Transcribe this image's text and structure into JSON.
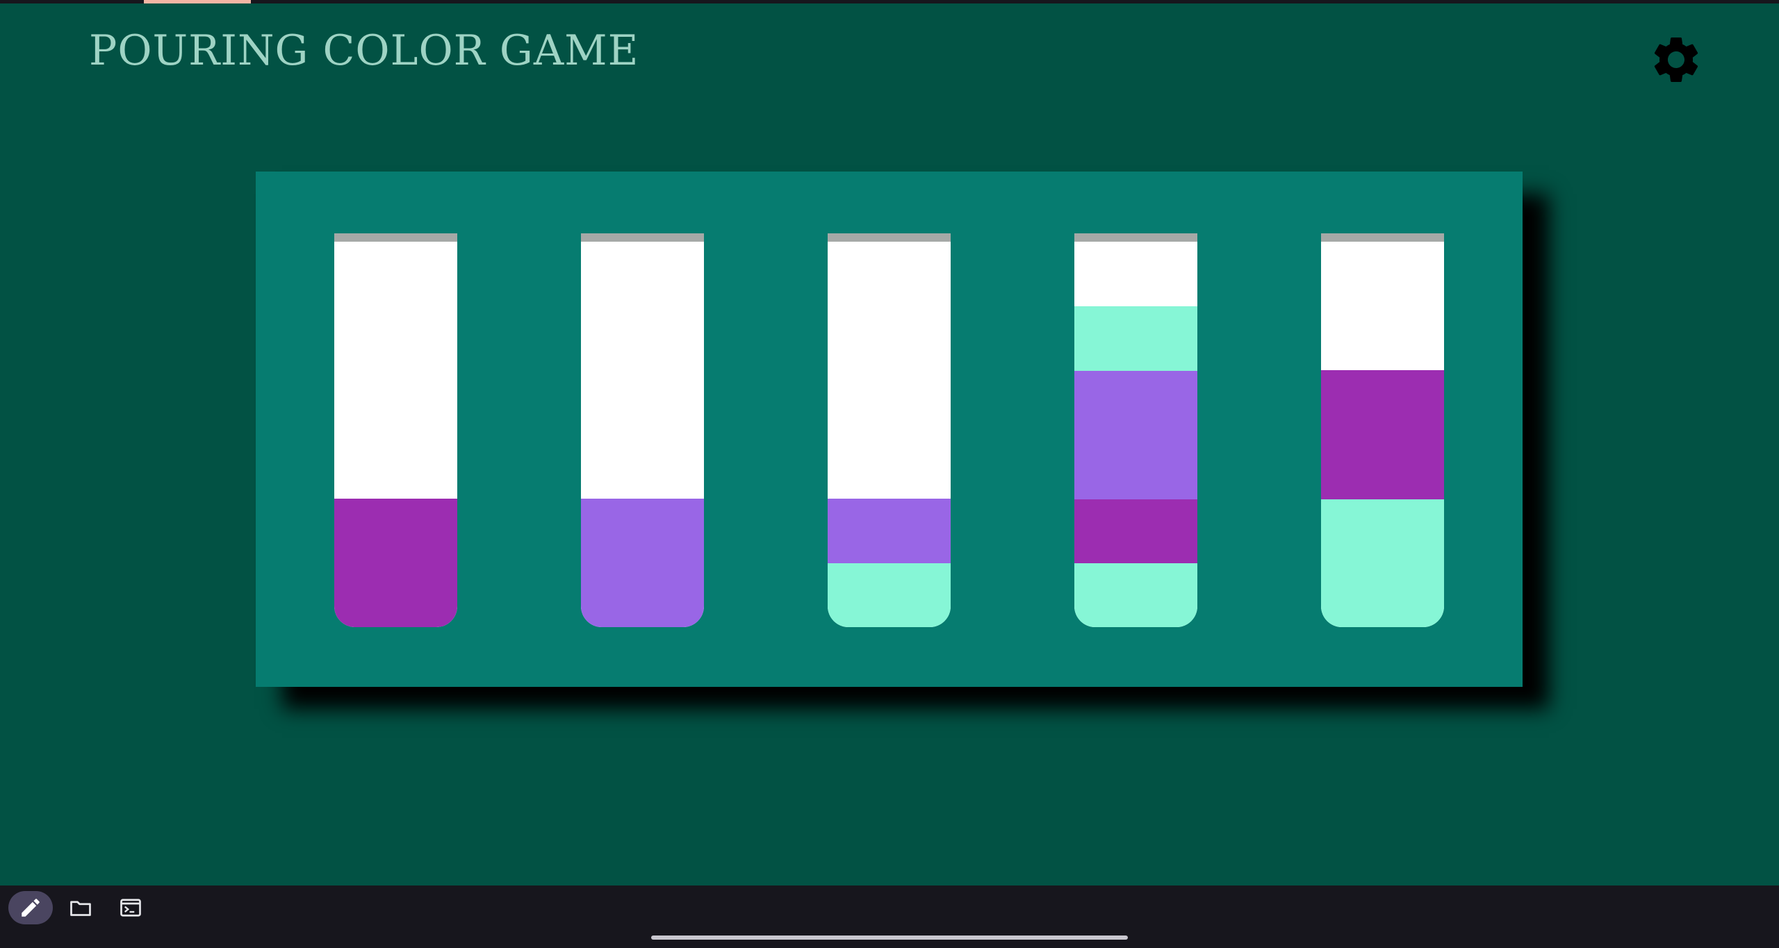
{
  "header": {
    "title": "POURING COLOR GAME"
  },
  "colors": {
    "background": "#025244",
    "board": "#067c70",
    "title": "#9ed3c4",
    "empty": "#ffffff",
    "rim": "#a5a9a7"
  },
  "tubes": [
    {
      "capacity": 6,
      "layers_bottom_to_top": [
        "#9c2db1",
        "#9c2db1"
      ]
    },
    {
      "capacity": 6,
      "layers_bottom_to_top": [
        "#9966e6",
        "#9966e6"
      ]
    },
    {
      "capacity": 6,
      "layers_bottom_to_top": [
        "#86f6d6",
        "#9966e6"
      ]
    },
    {
      "capacity": 6,
      "layers_bottom_to_top": [
        "#86f6d6",
        "#9c2db1",
        "#9966e6",
        "#9966e6",
        "#86f6d6"
      ]
    },
    {
      "capacity": 6,
      "layers_bottom_to_top": [
        "#86f6d6",
        "#86f6d6",
        "#9c2db1",
        "#9c2db1"
      ]
    }
  ],
  "icons": {
    "settings": "gear-icon",
    "edit": "pencil-icon",
    "files": "folder-icon",
    "terminal": "terminal-icon"
  }
}
